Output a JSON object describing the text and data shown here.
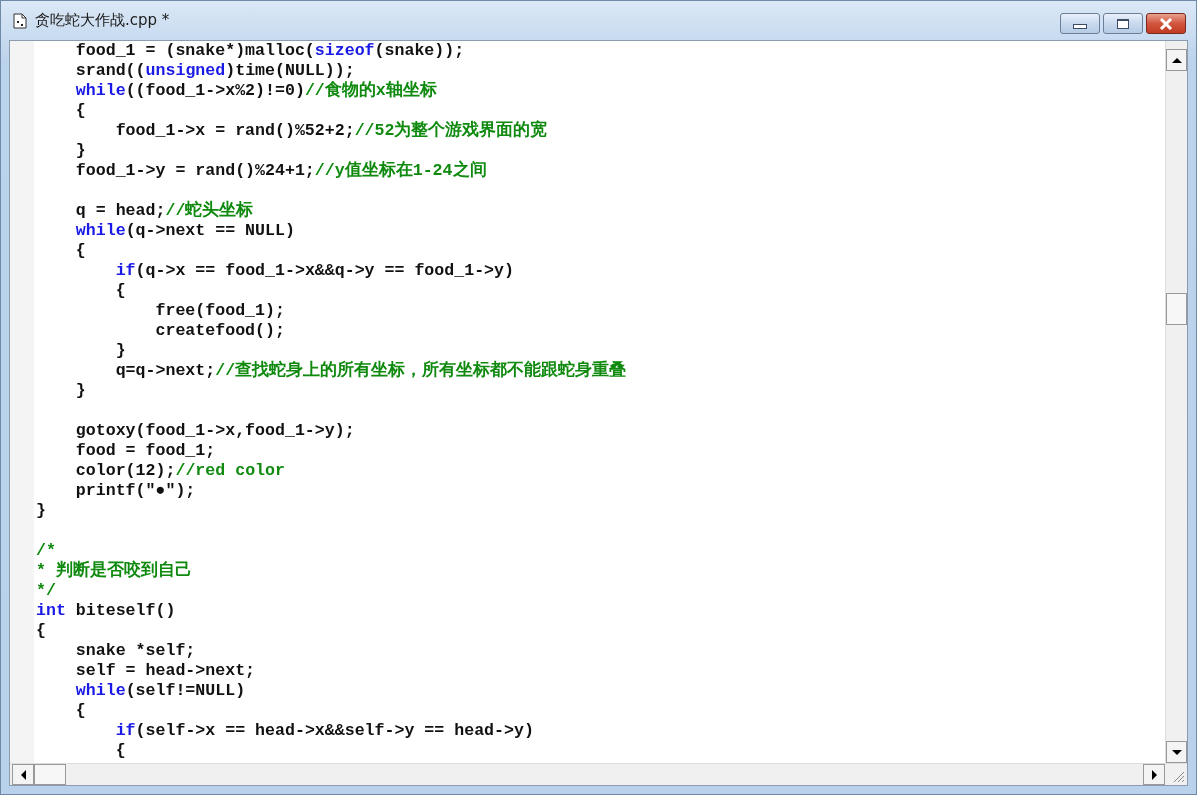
{
  "window": {
    "title": "贪吃蛇大作战.cpp *"
  },
  "editor": {
    "blocks": [
      {
        "lines": [
          {
            "segments": [
              {
                "kind": "code",
                "text": "    food_1 = (snake*)malloc("
              },
              {
                "kind": "keyword",
                "text": "sizeof"
              },
              {
                "kind": "code",
                "text": "(snake));"
              }
            ]
          },
          {
            "segments": [
              {
                "kind": "code",
                "text": "    srand(("
              },
              {
                "kind": "keyword",
                "text": "unsigned"
              },
              {
                "kind": "code",
                "text": ")time(NULL));"
              }
            ]
          },
          {
            "segments": [
              {
                "kind": "keyword",
                "text": "    while"
              },
              {
                "kind": "code",
                "text": "((food_1->x%2)!=0)"
              },
              {
                "kind": "comment",
                "text": "//食物的x轴坐标"
              }
            ]
          },
          {
            "segments": [
              {
                "kind": "code",
                "text": "    {"
              }
            ]
          },
          {
            "segments": [
              {
                "kind": "code",
                "text": "        food_1->x = rand()%52+2;"
              },
              {
                "kind": "comment",
                "text": "//52为整个游戏界面的宽"
              }
            ]
          },
          {
            "segments": [
              {
                "kind": "code",
                "text": "    }"
              }
            ]
          },
          {
            "segments": [
              {
                "kind": "code",
                "text": "    food_1->y = rand()%24+1;"
              },
              {
                "kind": "comment",
                "text": "//y值坐标在1-24之间"
              }
            ]
          }
        ]
      },
      {
        "lines": [
          {
            "segments": [
              {
                "kind": "code",
                "text": "    q = head;"
              },
              {
                "kind": "comment",
                "text": "//蛇头坐标"
              }
            ]
          },
          {
            "segments": [
              {
                "kind": "keyword",
                "text": "    while"
              },
              {
                "kind": "code",
                "text": "(q->next == NULL)"
              }
            ]
          },
          {
            "segments": [
              {
                "kind": "code",
                "text": "    {"
              }
            ]
          },
          {
            "segments": [
              {
                "kind": "keyword",
                "text": "        if"
              },
              {
                "kind": "code",
                "text": "(q->x == food_1->x&&q->y == food_1->y)"
              }
            ]
          },
          {
            "segments": [
              {
                "kind": "code",
                "text": "        {"
              }
            ]
          },
          {
            "segments": [
              {
                "kind": "code",
                "text": "            free(food_1);"
              }
            ]
          },
          {
            "segments": [
              {
                "kind": "code",
                "text": "            createfood();"
              }
            ]
          },
          {
            "segments": [
              {
                "kind": "code",
                "text": "        }"
              }
            ]
          },
          {
            "segments": [
              {
                "kind": "code",
                "text": "        q=q->next;"
              },
              {
                "kind": "comment",
                "text": "//查找蛇身上的所有坐标，所有坐标都不能跟蛇身重叠"
              }
            ]
          },
          {
            "segments": [
              {
                "kind": "code",
                "text": "    }"
              }
            ]
          }
        ]
      },
      {
        "lines": [
          {
            "segments": [
              {
                "kind": "code",
                "text": "    gotoxy(food_1->x,food_1->y);"
              }
            ]
          },
          {
            "segments": [
              {
                "kind": "code",
                "text": "    food = food_1;"
              }
            ]
          },
          {
            "segments": [
              {
                "kind": "code",
                "text": "    color(12);"
              },
              {
                "kind": "comment",
                "text": "//red color"
              }
            ]
          },
          {
            "segments": [
              {
                "kind": "code",
                "text": "    printf(\"●\");"
              }
            ]
          },
          {
            "segments": [
              {
                "kind": "code",
                "text": "}"
              }
            ]
          }
        ]
      },
      {
        "lines": [
          {
            "segments": [
              {
                "kind": "comment",
                "text": "/*"
              }
            ]
          },
          {
            "segments": [
              {
                "kind": "comment",
                "text": "* 判断是否咬到自己"
              }
            ]
          },
          {
            "segments": [
              {
                "kind": "comment",
                "text": "*/"
              }
            ]
          },
          {
            "segments": [
              {
                "kind": "keyword",
                "text": "int"
              },
              {
                "kind": "code",
                "text": " biteself()"
              }
            ]
          },
          {
            "segments": [
              {
                "kind": "code",
                "text": "{"
              }
            ]
          },
          {
            "segments": [
              {
                "kind": "code",
                "text": "    snake *self;"
              }
            ]
          },
          {
            "segments": [
              {
                "kind": "code",
                "text": "    self = head->next;"
              }
            ]
          },
          {
            "segments": [
              {
                "kind": "keyword",
                "text": "    while"
              },
              {
                "kind": "code",
                "text": "(self!=NULL)"
              }
            ]
          },
          {
            "segments": [
              {
                "kind": "code",
                "text": "    {"
              }
            ]
          },
          {
            "segments": [
              {
                "kind": "keyword",
                "text": "        if"
              },
              {
                "kind": "code",
                "text": "(self->x == head->x&&self->y == head->y)"
              }
            ]
          },
          {
            "segments": [
              {
                "kind": "code",
                "text": "        {"
              }
            ]
          }
        ]
      }
    ]
  }
}
